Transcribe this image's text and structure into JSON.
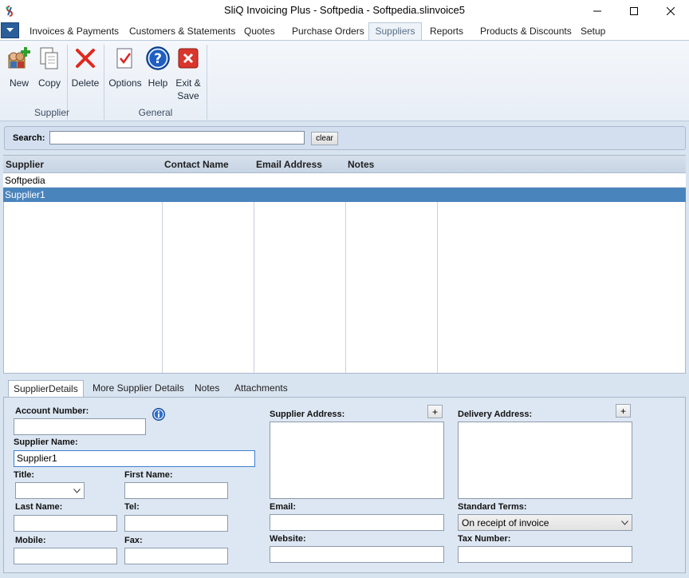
{
  "window": {
    "title": "SliQ Invoicing Plus - Softpedia - Softpedia.slinvoice5"
  },
  "menu": {
    "tabs": [
      {
        "label": "Invoices & Payments"
      },
      {
        "label": "Customers & Statements"
      },
      {
        "label": "Quotes"
      },
      {
        "label": "Purchase Orders"
      },
      {
        "label": "Suppliers"
      },
      {
        "label": "Reports"
      },
      {
        "label": "Products & Discounts"
      },
      {
        "label": "Setup"
      }
    ]
  },
  "ribbon": {
    "supplier_group": {
      "label": "Supplier",
      "new_label": "New",
      "copy_label": "Copy",
      "delete_label": "Delete"
    },
    "general_group": {
      "label": "General",
      "options_label": "Options",
      "help_label": "Help",
      "exit_label_1": "Exit &",
      "exit_label_2": "Save"
    }
  },
  "search": {
    "label": "Search:",
    "value": "",
    "clear_label": "clear"
  },
  "grid": {
    "columns": [
      "Supplier",
      "Contact Name",
      "Email Address",
      "Notes"
    ],
    "rows": [
      {
        "supplier": "Softpedia",
        "contact": "",
        "email": "",
        "notes": "",
        "selected": false
      },
      {
        "supplier": "Supplier1",
        "contact": "",
        "email": "",
        "notes": "",
        "selected": true
      }
    ]
  },
  "detail_tabs": [
    {
      "label": "SupplierDetails",
      "active": true
    },
    {
      "label": "More Supplier Details",
      "active": false
    },
    {
      "label": "Notes",
      "active": false
    },
    {
      "label": "Attachments",
      "active": false
    }
  ],
  "form": {
    "account_number_label": "Account Number:",
    "account_number": "",
    "supplier_name_label": "Supplier Name:",
    "supplier_name": "Supplier1",
    "title_label": "Title:",
    "title_value": "",
    "first_name_label": "First Name:",
    "first_name": "",
    "last_name_label": "Last Name:",
    "last_name": "",
    "tel_label": "Tel:",
    "tel": "",
    "mobile_label": "Mobile:",
    "mobile": "",
    "fax_label": "Fax:",
    "fax": "",
    "supplier_address_label": "Supplier Address:",
    "supplier_address": "",
    "email_label": "Email:",
    "email": "",
    "website_label": "Website:",
    "website": "",
    "delivery_address_label": "Delivery Address:",
    "delivery_address": "",
    "standard_terms_label": "Standard Terms:",
    "standard_terms": "On receipt of invoice",
    "tax_number_label": "Tax Number:",
    "tax_number": "",
    "plus_label": "+"
  },
  "colors": {
    "accent": "#2b5e9b",
    "selected_row": "#4a84bd",
    "panel_bg": "#d9e4f1"
  }
}
